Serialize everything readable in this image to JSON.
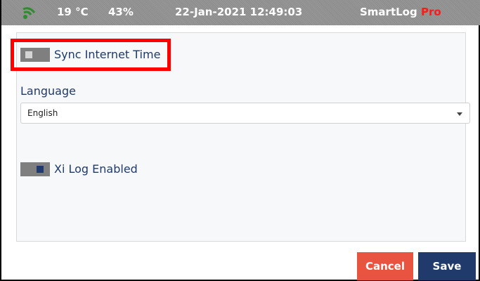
{
  "status_bar": {
    "temperature": "19 °C",
    "humidity": "43%",
    "datetime": "22-Jan-2021 12:49:03",
    "brand_name": "SmartLog",
    "brand_suffix": "Pro"
  },
  "settings": {
    "sync_internet_time": {
      "label": "Sync Internet Time",
      "enabled": false
    },
    "language": {
      "label": "Language",
      "selected": "English"
    },
    "xi_log": {
      "label": "Xi Log Enabled",
      "enabled": true
    }
  },
  "buttons": {
    "cancel": "Cancel",
    "save": "Save"
  },
  "colors": {
    "accent_blue": "#1f3a6b",
    "cancel_red": "#e8543f",
    "highlight_red": "#ff0000",
    "wifi_green": "#2e8b2e",
    "brand_pro_red": "#ff1a1a"
  }
}
